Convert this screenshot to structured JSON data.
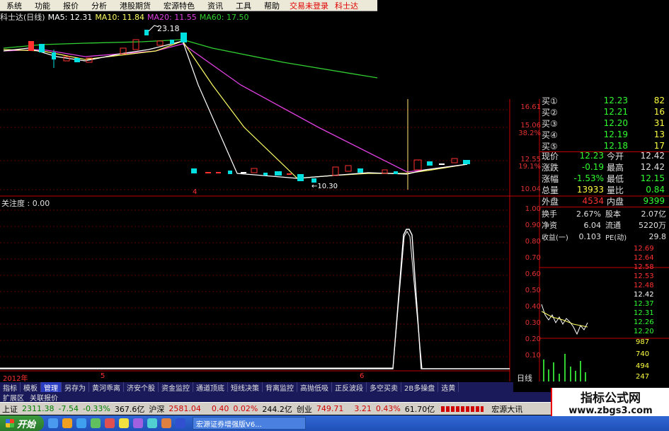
{
  "menu": {
    "items": [
      "系统",
      "功能",
      "报价",
      "分析",
      "港股期货",
      "宏源特色",
      "资讯",
      "工具",
      "帮助"
    ],
    "login": "交易未登录",
    "app": "科士达"
  },
  "ma_header": {
    "name": "科士达(日线)",
    "ma5": "MA5: 12.31",
    "ma10": "MA10: 11.84",
    "ma20": "MA20: 11.55",
    "ma60": "MA60: 17.50"
  },
  "annotations": {
    "high": "23.18",
    "low": "←10.30",
    "marker4": "4"
  },
  "price_axis": {
    "ticks": [
      "16.61",
      "15.06",
      "38.2%",
      "12.55",
      "19.1%",
      "10.04"
    ]
  },
  "indicator": {
    "title": "关注度 : 0.00",
    "ticks": [
      "1.00",
      "0.90",
      "0.80",
      "0.70",
      "0.60",
      "0.50",
      "0.40",
      "0.30",
      "0.20",
      "0.10"
    ]
  },
  "timeline": {
    "labels": [
      "2012年",
      "5",
      "6"
    ],
    "daily": "日线"
  },
  "quotes": {
    "buy": [
      {
        "label": "买①",
        "price": "12.23",
        "vol": "82"
      },
      {
        "label": "买②",
        "price": "12.21",
        "vol": "16"
      },
      {
        "label": "买③",
        "price": "12.20",
        "vol": "31"
      },
      {
        "label": "买④",
        "price": "12.19",
        "vol": "13"
      },
      {
        "label": "买⑤",
        "price": "12.18",
        "vol": "17"
      }
    ],
    "stats": [
      {
        "l1": "现价",
        "v1": "12.23",
        "l2": "今开",
        "v2": "12.42"
      },
      {
        "l1": "涨跌",
        "v1": "-0.19",
        "l2": "最高",
        "v2": "12.42"
      },
      {
        "l1": "涨幅",
        "v1": "-1.53%",
        "l2": "最低",
        "v2": "12.15"
      },
      {
        "l1": "总量",
        "v1": "13933",
        "l2": "量比",
        "v2": "0.84"
      },
      {
        "l1": "外盘",
        "v1": "4534",
        "l2": "内盘",
        "v2": "9399"
      }
    ],
    "stats2": [
      {
        "l1": "换手",
        "v1": "2.67%",
        "l2": "股本",
        "v2": "2.07亿"
      },
      {
        "l1": "净资",
        "v1": "6.04",
        "l2": "流通",
        "v2": "5220万"
      },
      {
        "l1": "收益(一)",
        "v1": "0.103",
        "l2": "PE(动)",
        "v2": "29.8"
      }
    ]
  },
  "mini_chart": {
    "ticks": [
      "12.69",
      "12.64",
      "12.58",
      "12.53",
      "12.48",
      "12.42",
      "12.37",
      "12.31",
      "12.26",
      "12.20"
    ],
    "vol_ticks": [
      "987",
      "740",
      "494",
      "247"
    ]
  },
  "tabs": [
    "指标",
    "模板",
    "管理",
    "另存为",
    "黄河乖离",
    "济安个股",
    "资金监控",
    "通道顶底",
    "短线决策",
    "背离监控",
    "高抛低吸",
    "正反波段",
    "多空买卖",
    "2B多操盘",
    "选黄"
  ],
  "tabs_active": 2,
  "tabs2": [
    "扩展区",
    "关联报价"
  ],
  "status": {
    "sh_label": "上证",
    "sh_val": "2311.38",
    "sh_chg": "-7.54",
    "sh_pct": "-0.33%",
    "sh_amt": "367.6亿",
    "sz_label": "沪深",
    "sz_val": "2581.04",
    "sz_chg": "0.40",
    "sz_pct": "0.02%",
    "sz_amt": "244.2亿",
    "cy_label": "创业",
    "cy_val": "749.71",
    "cy_chg": "3.21",
    "cy_pct": "0.43%",
    "cy_amt": "61.70亿",
    "broker": "宏源大讯"
  },
  "taskbar": {
    "start": "开始",
    "item": "宏源证券增强版V6..."
  },
  "watermark": {
    "line1": "指标公式网",
    "line2": "www.zbgs3.com"
  },
  "colors": {
    "up": "#ff3030",
    "down": "#00e0e0",
    "ma5": "#ffffff",
    "ma10": "#ffff66",
    "ma20": "#e040e0",
    "ma60": "#30d030",
    "axis": "#c00000"
  }
}
